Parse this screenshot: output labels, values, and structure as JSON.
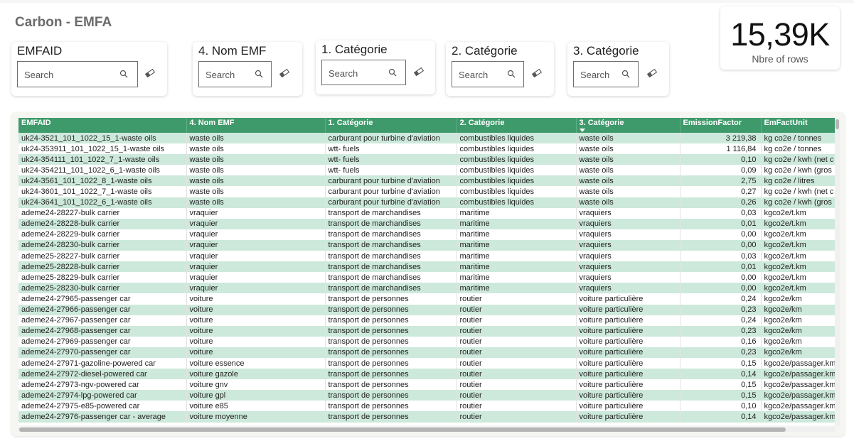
{
  "title": "Carbon - EMFA",
  "search_placeholder": "Search",
  "slicers": [
    {
      "title": "EMFAID"
    },
    {
      "title": "4. Nom EMF"
    },
    {
      "title": "1. Catégorie"
    },
    {
      "title": "2. Catégorie"
    },
    {
      "title": "3. Catégorie"
    }
  ],
  "kpi": {
    "value": "15,39K",
    "label": "Nbre of rows"
  },
  "table": {
    "columns": [
      "EMFAID",
      "4. Nom EMF",
      "1. Catégorie",
      "2. Catégorie",
      "3. Catégorie",
      "EmissionFactor",
      "EmFactUnit"
    ],
    "sorted_column": "3. Catégorie",
    "rows": [
      [
        "uk24-3521_101_1022_15_1-waste oils",
        "waste oils",
        "carburant pour turbine d'aviation",
        "combustibles liquides",
        "waste oils",
        "3 219,38",
        "kg co2e / tonnes"
      ],
      [
        "uk24-353911_101_1022_15_1-waste oils",
        "waste oils",
        "wtt- fuels",
        "combustibles liquides",
        "waste oils",
        "1 116,84",
        "kg co2e / tonnes"
      ],
      [
        "uk24-354111_101_1022_7_1-waste oils",
        "waste oils",
        "wtt- fuels",
        "combustibles liquides",
        "waste oils",
        "0,10",
        "kg co2e / kwh (net c"
      ],
      [
        "uk24-354211_101_1022_6_1-waste oils",
        "waste oils",
        "wtt- fuels",
        "combustibles liquides",
        "waste oils",
        "0,09",
        "kg co2e / kwh (gros"
      ],
      [
        "uk24-3561_101_1022_8_1-waste oils",
        "waste oils",
        "carburant pour turbine d'aviation",
        "combustibles liquides",
        "waste oils",
        "2,75",
        "kg co2e / litres"
      ],
      [
        "uk24-3601_101_1022_7_1-waste oils",
        "waste oils",
        "carburant pour turbine d'aviation",
        "combustibles liquides",
        "waste oils",
        "0,27",
        "kg co2e / kwh (net c"
      ],
      [
        "uk24-3641_101_1022_6_1-waste oils",
        "waste oils",
        "carburant pour turbine d'aviation",
        "combustibles liquides",
        "waste oils",
        "0,26",
        "kg co2e / kwh (gros"
      ],
      [
        "ademe24-28227-bulk carrier",
        "vraquier",
        "transport de marchandises",
        "maritime",
        "vraquiers",
        "0,03",
        "kgco2e/t.km"
      ],
      [
        "ademe24-28228-bulk carrier",
        "vraquier",
        "transport de marchandises",
        "maritime",
        "vraquiers",
        "0,01",
        "kgco2e/t.km"
      ],
      [
        "ademe24-28229-bulk carrier",
        "vraquier",
        "transport de marchandises",
        "maritime",
        "vraquiers",
        "0,00",
        "kgco2e/t.km"
      ],
      [
        "ademe24-28230-bulk carrier",
        "vraquier",
        "transport de marchandises",
        "maritime",
        "vraquiers",
        "0,00",
        "kgco2e/t.km"
      ],
      [
        "ademe25-28227-bulk carrier",
        "vraquier",
        "transport de marchandises",
        "maritime",
        "vraquiers",
        "0,03",
        "kgco2e/t.km"
      ],
      [
        "ademe25-28228-bulk carrier",
        "vraquier",
        "transport de marchandises",
        "maritime",
        "vraquiers",
        "0,01",
        "kgco2e/t.km"
      ],
      [
        "ademe25-28229-bulk carrier",
        "vraquier",
        "transport de marchandises",
        "maritime",
        "vraquiers",
        "0,00",
        "kgco2e/t.km"
      ],
      [
        "ademe25-28230-bulk carrier",
        "vraquier",
        "transport de marchandises",
        "maritime",
        "vraquiers",
        "0,00",
        "kgco2e/t.km"
      ],
      [
        "ademe24-27965-passenger car",
        "voiture",
        "transport de personnes",
        "routier",
        "voiture particulière",
        "0,24",
        "kgco2e/km"
      ],
      [
        "ademe24-27966-passenger car",
        "voiture",
        "transport de personnes",
        "routier",
        "voiture particulière",
        "0,23",
        "kgco2e/km"
      ],
      [
        "ademe24-27967-passenger car",
        "voiture",
        "transport de personnes",
        "routier",
        "voiture particulière",
        "0,24",
        "kgco2e/km"
      ],
      [
        "ademe24-27968-passenger car",
        "voiture",
        "transport de personnes",
        "routier",
        "voiture particulière",
        "0,23",
        "kgco2e/km"
      ],
      [
        "ademe24-27969-passenger car",
        "voiture",
        "transport de personnes",
        "routier",
        "voiture particulière",
        "0,16",
        "kgco2e/km"
      ],
      [
        "ademe24-27970-passenger car",
        "voiture",
        "transport de personnes",
        "routier",
        "voiture particulière",
        "0,23",
        "kgco2e/km"
      ],
      [
        "ademe24-27971-gazoline-powered car",
        "voiture essence",
        "transport de personnes",
        "routier",
        "voiture particulière",
        "0,15",
        "kgco2e/passager.km"
      ],
      [
        "ademe24-27972-diesel-powered car",
        "voiture gazole",
        "transport de personnes",
        "routier",
        "voiture particulière",
        "0,14",
        "kgco2e/passager.km"
      ],
      [
        "ademe24-27973-ngv-powered car",
        "voiture gnv",
        "transport de personnes",
        "routier",
        "voiture particulière",
        "0,15",
        "kgco2e/passager.km"
      ],
      [
        "ademe24-27974-lpg-powered car",
        "voiture gpl",
        "transport de personnes",
        "routier",
        "voiture particulière",
        "0,15",
        "kgco2e/passager.km"
      ],
      [
        "ademe24-27975-e85-powered car",
        "voiture e85",
        "transport de personnes",
        "routier",
        "voiture particulière",
        "0,10",
        "kgco2e/passager.km"
      ],
      [
        "ademe24-27976-passenger car - average",
        "voiture moyenne",
        "transport de personnes",
        "routier",
        "voiture particulière",
        "0,14",
        "kgco2e/passager.km"
      ]
    ]
  }
}
